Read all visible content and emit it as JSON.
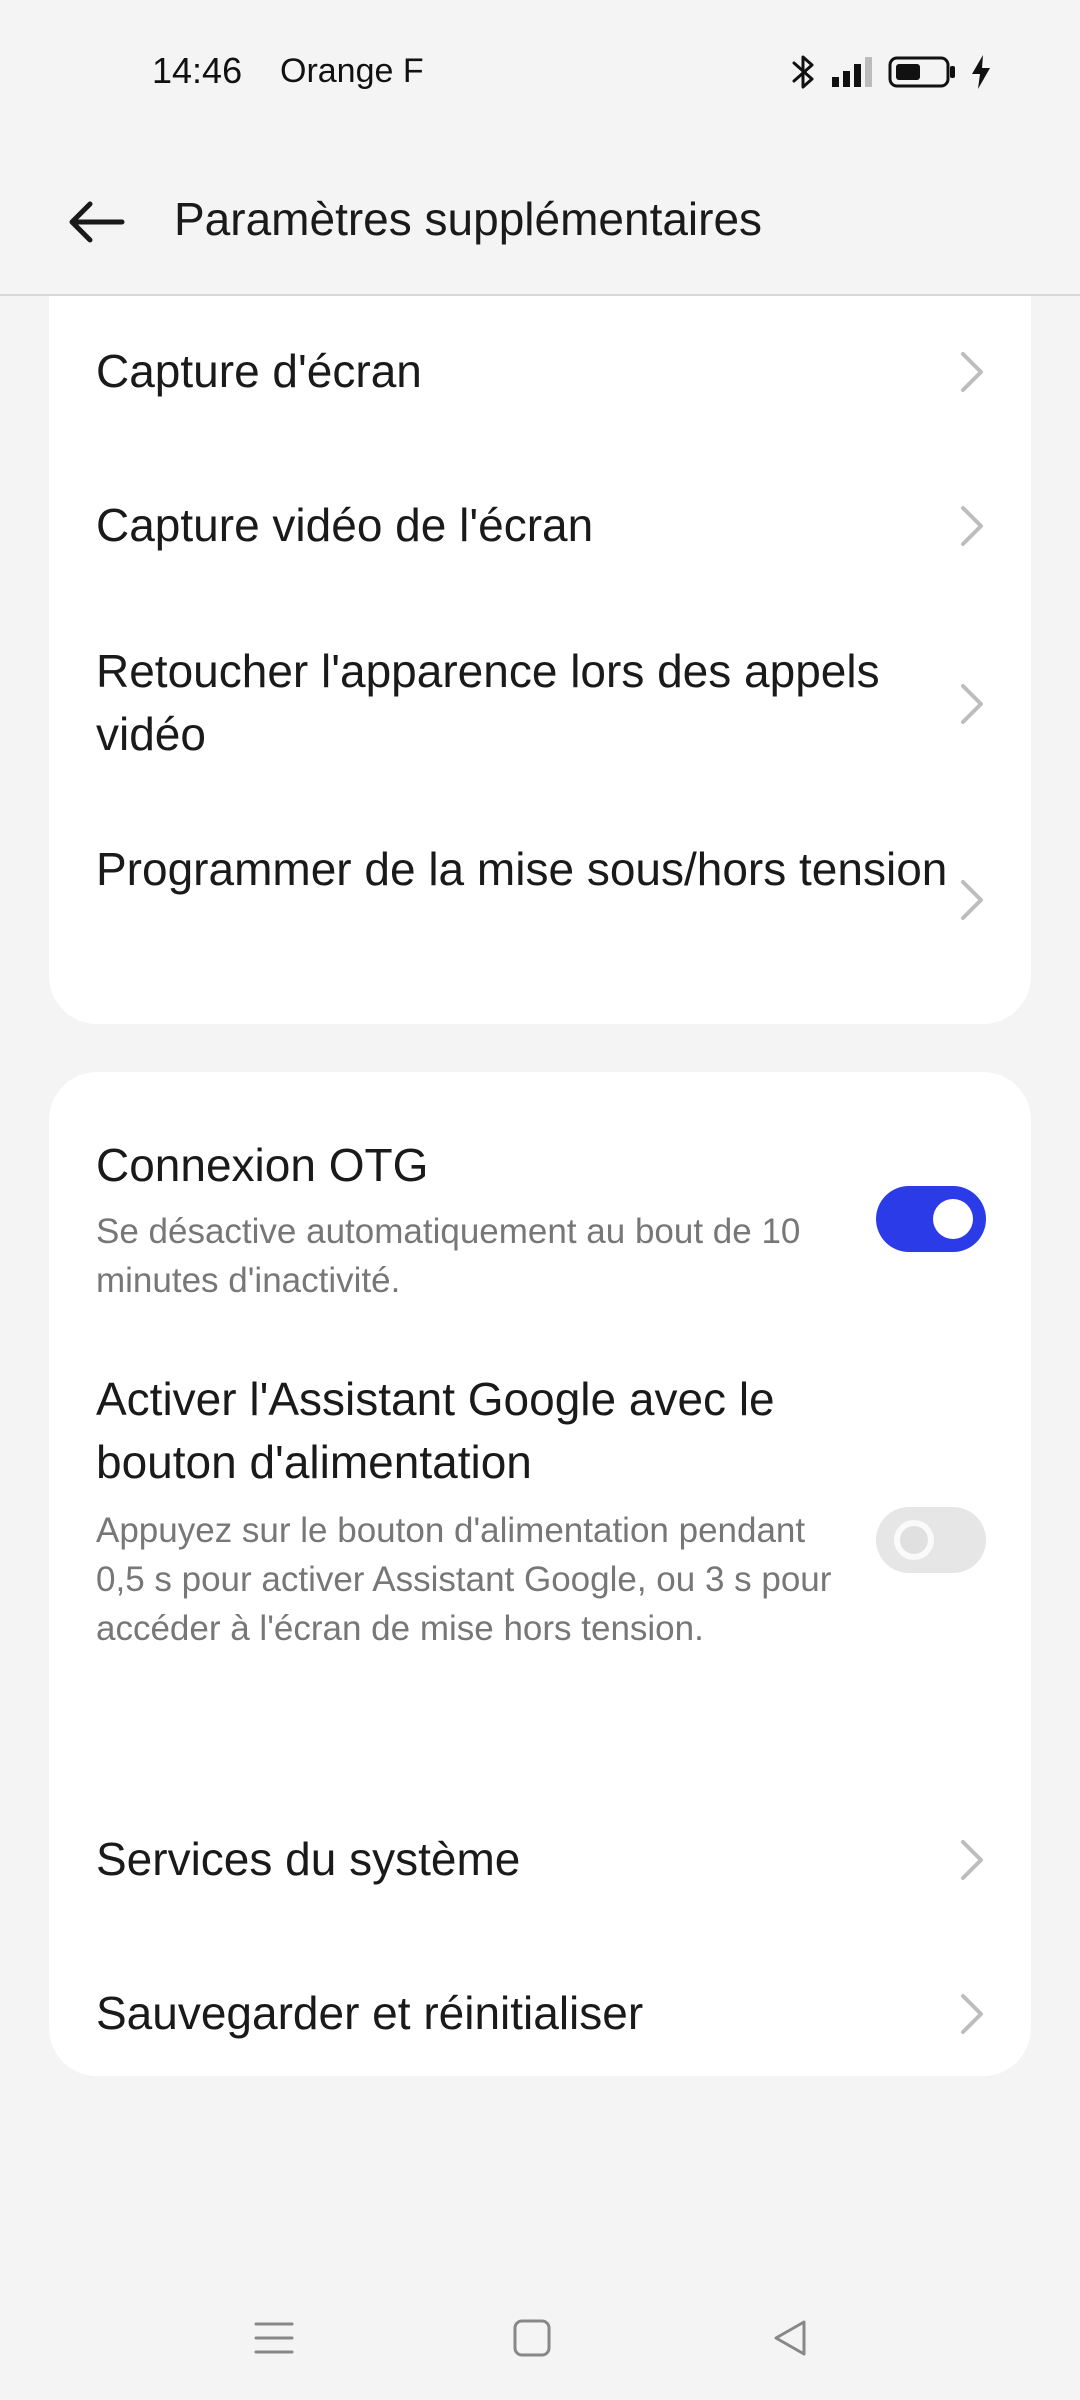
{
  "status_bar": {
    "time": "14:46",
    "carrier": "Orange F",
    "icons": [
      "bluetooth-icon",
      "signal-icon",
      "battery-icon",
      "charging-icon"
    ]
  },
  "header": {
    "back_icon": "arrow-left-icon",
    "title": "Paramètres supplémentaires"
  },
  "card1": {
    "items": [
      {
        "label": "Capture d'écran"
      },
      {
        "label": "Capture vidéo de l'écran"
      },
      {
        "label": "Retoucher l'apparence lors des appels vidéo"
      },
      {
        "label": "Programmer de la mise sous/hors tension"
      }
    ]
  },
  "card2": {
    "otg": {
      "title": "Connexion OTG",
      "subtitle": "Se désactive automatiquement au bout de 10 minutes d'inactivité.",
      "enabled": true
    },
    "assistant": {
      "title": "Activer l'Assistant Google avec le bouton d'alimentation",
      "subtitle": "Appuyez sur le bouton d'alimentation pendant 0,5 s pour activer Assistant Google, ou 3 s pour accéder à l'écran de mise hors tension.",
      "enabled": false
    },
    "items": [
      {
        "label": "Services du système"
      },
      {
        "label": "Sauvegarder et réinitialiser"
      }
    ]
  },
  "colors": {
    "accent": "#2b3be8",
    "background": "#f4f4f4",
    "card": "#ffffff"
  },
  "nav_bar": {
    "icons": [
      "menu-icon",
      "home-icon",
      "back-triangle-icon"
    ]
  }
}
